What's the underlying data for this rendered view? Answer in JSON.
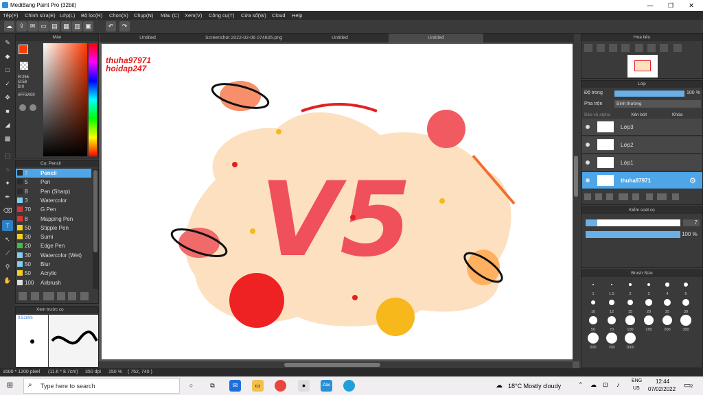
{
  "window": {
    "title": "MediBang Paint Pro (32bit)",
    "min": "—",
    "max": "❐",
    "close": "✕"
  },
  "menu": [
    "Tệp(F)",
    "Chỉnh sửa(E)",
    "Lớp(L)",
    "Bộ lọc(R)",
    "Chọn(S)",
    "Chụp(N)",
    "Màu (C)",
    "Xem(V)",
    "Công cụ(T)",
    "Cửa sổ(W)",
    "Cloud",
    "Help"
  ],
  "color_panel": {
    "title": "Màu",
    "r": "R:255",
    "g": "G:58",
    "b": "B:0",
    "hex": "#FF3A00",
    "fg": "#FF3A00",
    "bg": "#3a7bd5"
  },
  "brush_panel": {
    "title": "Cọ: Pencil",
    "items": [
      {
        "size": "7",
        "name": "Pencil",
        "color": "#2b2b2b",
        "selected": true
      },
      {
        "size": "5",
        "name": "Pen",
        "color": "#2b2b2b"
      },
      {
        "size": "8",
        "name": "Pen (Sharp)",
        "color": "#2b2b2b"
      },
      {
        "size": "3",
        "name": "Watercolor",
        "color": "#7fd0f0"
      },
      {
        "size": "70",
        "name": "G Pen",
        "color": "#e03030"
      },
      {
        "size": "8",
        "name": "Mapping Pen",
        "color": "#e03030"
      },
      {
        "size": "50",
        "name": "Stipple Pen",
        "color": "#f0d020"
      },
      {
        "size": "30",
        "name": "Sumi",
        "color": "#f0d020"
      },
      {
        "size": "20",
        "name": "Edge Pen",
        "color": "#40c040"
      },
      {
        "size": "30",
        "name": "Watercolor (Wet)",
        "color": "#7fd0f0"
      },
      {
        "size": "50",
        "name": "Blur",
        "color": "#7fd0f0"
      },
      {
        "size": "50",
        "name": "Acrylic",
        "color": "#f0d020"
      },
      {
        "size": "100",
        "name": "Airbrush",
        "color": "#dddddd"
      }
    ]
  },
  "preview_panel": {
    "title": "Xem trước cọ",
    "size_label": "0.51mm"
  },
  "tabs": [
    "Untitled",
    "Screenshot 2022-02-06 074605.png",
    "Untitled",
    "Untitled"
  ],
  "canvas": {
    "watermark_1": "thuha97971",
    "watermark_2": "hoidap247",
    "big_text": "V5"
  },
  "navigator": {
    "title": "Hoa tiêu"
  },
  "layer_panel": {
    "title": "Lớp",
    "opacity_label": "Độ trong",
    "opacity_value": "100 %",
    "blend_label": "Pha trộn",
    "blend_value": "Bình thường",
    "protect_alpha": "Bảo vệ alpha",
    "clipping": "Xén bớt",
    "lock": "Khóa",
    "layers": [
      {
        "name": "Lớp3"
      },
      {
        "name": "Lớp2"
      },
      {
        "name": "Lớp1"
      },
      {
        "name": "thuha97971",
        "selected": true
      }
    ]
  },
  "brush_control": {
    "title": "Kiểm soát cọ",
    "size": "7",
    "opacity": "100 %",
    "size_fill": 0.12,
    "opacity_fill": 1.0
  },
  "brush_size": {
    "title": "Brush Size",
    "sizes": [
      "1",
      "1.5",
      "2",
      "3",
      "4",
      "5",
      "10",
      "12",
      "15",
      "20",
      "25",
      "30",
      "50",
      "70",
      "100",
      "150",
      "200",
      "300",
      "500",
      "700",
      "1000"
    ]
  },
  "status": {
    "pixels": "1600 * 1200 pixel",
    "cm": "(11.6 * 8.7cm)",
    "dpi": "350 dpi",
    "zoom": "150 %",
    "coords": "( 752, 740 )"
  },
  "taskbar": {
    "search_placeholder": "Type here to search",
    "weather": "18°C  Mostly cloudy",
    "lang1": "ENG",
    "lang2": "US",
    "time": "12:44",
    "date": "07/02/2022",
    "notif": "2"
  }
}
